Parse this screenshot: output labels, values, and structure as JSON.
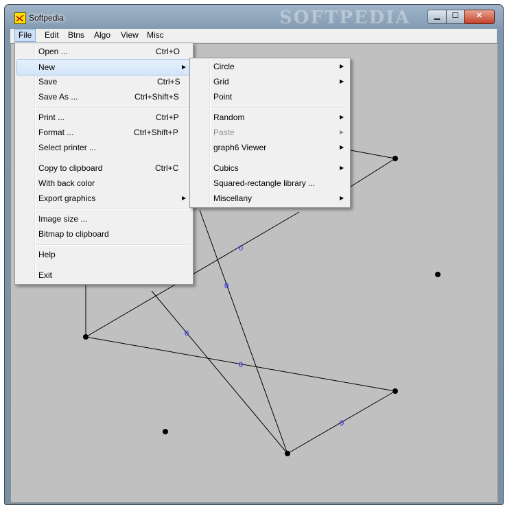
{
  "window": {
    "title": "Softpedia",
    "watermark": "SOFTPEDIA"
  },
  "window_controls": {
    "minimize": "▁",
    "maximize": "☐",
    "close": "✕"
  },
  "menubar": {
    "items": [
      "File",
      "Edit",
      "Btns",
      "Algo",
      "View",
      "Misc"
    ]
  },
  "file_menu": {
    "items": [
      {
        "label": "Open ...",
        "shortcut": "Ctrl+O"
      },
      {
        "label": "New",
        "shortcut": "",
        "submenu": true
      },
      {
        "label": "Save",
        "shortcut": "Ctrl+S"
      },
      {
        "label": "Save As ...",
        "shortcut": "Ctrl+Shift+S"
      },
      {
        "label": "Print ...",
        "shortcut": "Ctrl+P"
      },
      {
        "label": "Format ...",
        "shortcut": "Ctrl+Shift+P"
      },
      {
        "label": "Select printer ...",
        "shortcut": ""
      },
      {
        "label": "Copy to clipboard",
        "shortcut": "Ctrl+C"
      },
      {
        "label": "With back color",
        "shortcut": ""
      },
      {
        "label": "Export graphics",
        "shortcut": "",
        "submenu": true
      },
      {
        "label": "Image size ...",
        "shortcut": ""
      },
      {
        "label": "Bitmap to clipboard",
        "shortcut": ""
      },
      {
        "label": "Help",
        "shortcut": ""
      },
      {
        "label": "Exit",
        "shortcut": ""
      }
    ]
  },
  "new_submenu": {
    "items": [
      {
        "label": "Circle",
        "submenu": true
      },
      {
        "label": "Grid",
        "submenu": true
      },
      {
        "label": "Point"
      },
      {
        "label": "Random",
        "submenu": true
      },
      {
        "label": "Paste",
        "submenu": true,
        "disabled": true
      },
      {
        "label": "graph6 Viewer",
        "submenu": true
      },
      {
        "label": "Cubics",
        "submenu": true
      },
      {
        "label": "Squared-rectangle library ..."
      },
      {
        "label": "Miscellany",
        "submenu": true
      }
    ]
  },
  "graph": {
    "edge_label": "0",
    "edge_label_color": "#1a1aff",
    "vertex_color": "#000000",
    "edge_color": "#000000",
    "background_color": "#c0c0c0"
  },
  "icons": {
    "app": "graph-app-icon",
    "submenu_arrow": "▶"
  }
}
